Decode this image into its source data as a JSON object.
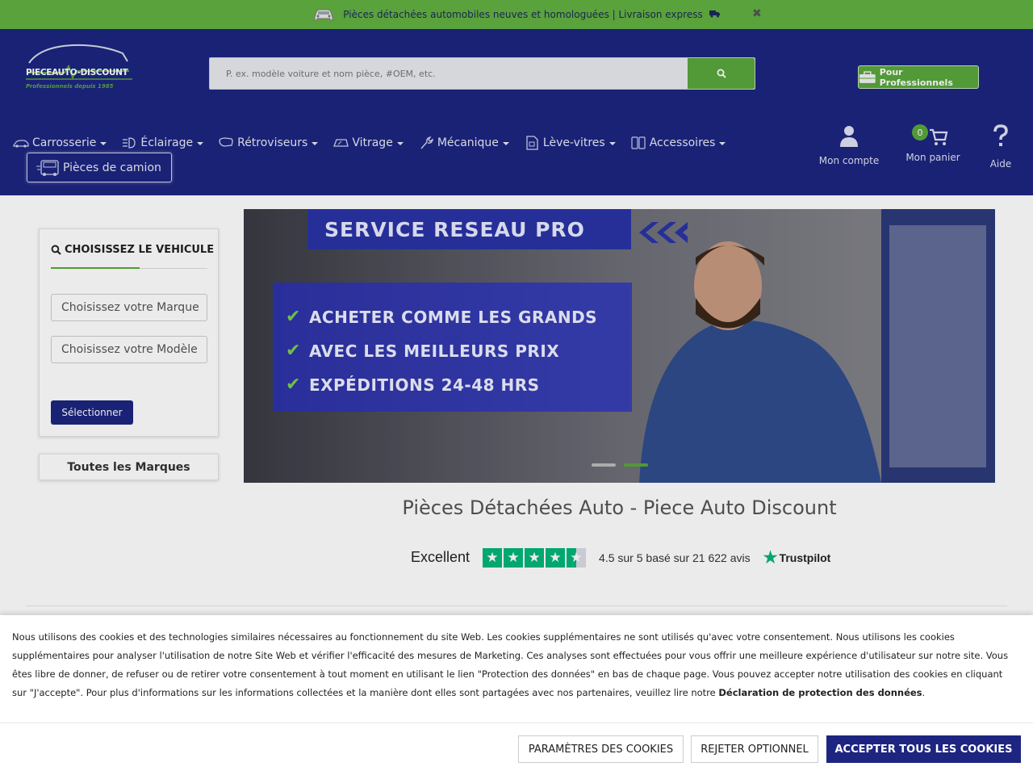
{
  "topbar": {
    "text": "Pièces détachées automobiles neuves et homologuées | Livraison express",
    "close": "✖"
  },
  "header": {
    "logo_text": "PIECEAUTO-DISCOUNT",
    "logo_sub": "Professionnels depuis 1985",
    "search_placeholder": "P. ex. modèle voiture et nom pièce, #OEM, etc.",
    "pro_button": "Pour Professionnels",
    "nav": [
      {
        "label": "Carrosserie"
      },
      {
        "label": "Éclairage"
      },
      {
        "label": "Rétroviseurs"
      },
      {
        "label": "Vitrage"
      },
      {
        "label": "Mécanique"
      },
      {
        "label": "Lève-vitres"
      },
      {
        "label": "Accessoires"
      }
    ],
    "truck_button": "Pièces de camion",
    "account": "Mon compte",
    "cart": "Mon panier",
    "cart_count": "0",
    "help": "Aide"
  },
  "vehicle": {
    "title": "CHOISISSEZ LE VEHICULE",
    "brand_select": "Choisissez votre Marque",
    "model_select": "Choisissez votre Modèle",
    "button": "Sélectionner",
    "all_brands": "Toutes les Marques"
  },
  "banner": {
    "title": "SERVICE RESEAU PRO",
    "items": [
      "ACHETER COMME LES GRANDS",
      "AVEC LES MEILLEURS PRIX",
      "EXPÉDITIONS 24-48 HRS"
    ],
    "active_slide": 2,
    "slides": 2
  },
  "page_title": "Pièces Détachées Auto - Piece Auto Discount",
  "trustpilot": {
    "label": "Excellent",
    "rating_text": "4.5 sur 5 basé sur 21 622 avis",
    "rating": 4.5,
    "brand": "Trustpilot"
  },
  "cookie": {
    "text": "Nous utilisons des cookies et des technologies similaires nécessaires au fonctionnement du site Web. Les cookies supplémentaires ne sont utilisés qu'avec votre consentement. Nous utilisons les cookies supplémentaires pour analyser l'utilisation de notre Site Web et vérifier l'efficacité des mesures de Marketing. Ces analyses sont effectuées pour vous offrir une meilleure expérience d'utilisateur sur notre site. Vous êtes libre de donner, de refuser ou de retirer votre consentement à tout moment en utilisant le lien \"Protection des données\" en bas de chaque page. Vous pouvez accepter notre utilisation des cookies en cliquant sur \"J'accepte\". Pour plus d'informations sur les informations collectées et la manière dont elles sont partagées avec nos partenaires, veuillez lire notre ",
    "link": "Déclaration de protection des données",
    "end": ".",
    "settings": "PARAMÈTRES DES COOKIES",
    "reject": "REJETER OPTIONNEL",
    "accept": "ACCEPTER TOUS LES COOKIES"
  },
  "colors": {
    "navy": "#1d2580",
    "green": "#5aa73c",
    "topbar_green": "#62b040",
    "trustpilot_green": "#00b67a"
  }
}
